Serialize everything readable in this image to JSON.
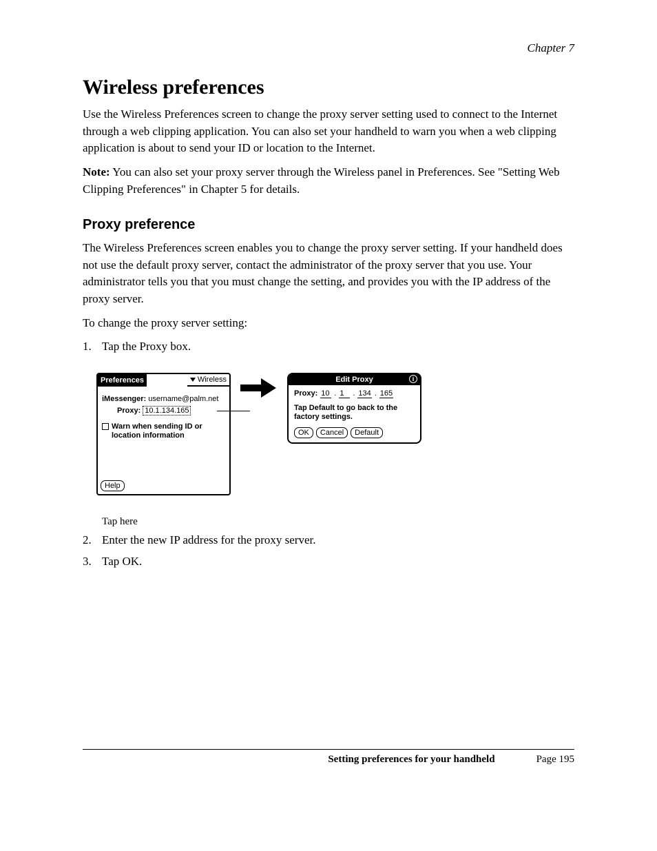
{
  "header": {
    "chapter": "Chapter 7"
  },
  "section": {
    "title": "Wireless preferences",
    "intro": "Use the Wireless Preferences screen to change the proxy server setting used to connect to the Internet through a web clipping application. You can also set your handheld to warn you when a web clipping application is about to send your ID or location to the Internet.",
    "note_label": "Note:",
    "note_body": "You can also set your proxy server through the Wireless panel in Preferences. See \"Setting Web Clipping Preferences\" in Chapter 5 for details."
  },
  "proxy": {
    "heading": "Proxy preference",
    "body": "The Wireless Preferences screen enables you to change the proxy server setting. If your handheld does not use the default proxy server, contact the administrator of the proxy server that you use. Your administrator tells you that you must change the setting, and provides you with the IP address of the proxy server.",
    "steps_heading": "To change the proxy server setting:",
    "steps": {
      "s1": "Tap the Proxy box.",
      "s2": "Enter the new IP address for the proxy server.",
      "s3": "Tap OK."
    }
  },
  "figure": {
    "prefs": {
      "title": "Preferences",
      "dropdown": "Wireless",
      "imessenger_label": "iMessenger:",
      "imessenger_value": "username@palm.net",
      "proxy_label": "Proxy:",
      "proxy_value": "10.1.134.165",
      "warn_label": "Warn when sending ID or location information",
      "help_btn": "Help"
    },
    "dialog": {
      "title": "Edit Proxy",
      "proxy_label": "Proxy:",
      "ip": {
        "a": "10",
        "b": "1",
        "c": "134",
        "d": "165"
      },
      "msg": "Tap Default to go back to the factory settings.",
      "ok": "OK",
      "cancel": "Cancel",
      "default": "Default",
      "info_glyph": "i"
    }
  },
  "callout": {
    "text": "Tap here"
  },
  "footer": {
    "title": "Setting preferences for your handheld",
    "page": "Page 195"
  }
}
